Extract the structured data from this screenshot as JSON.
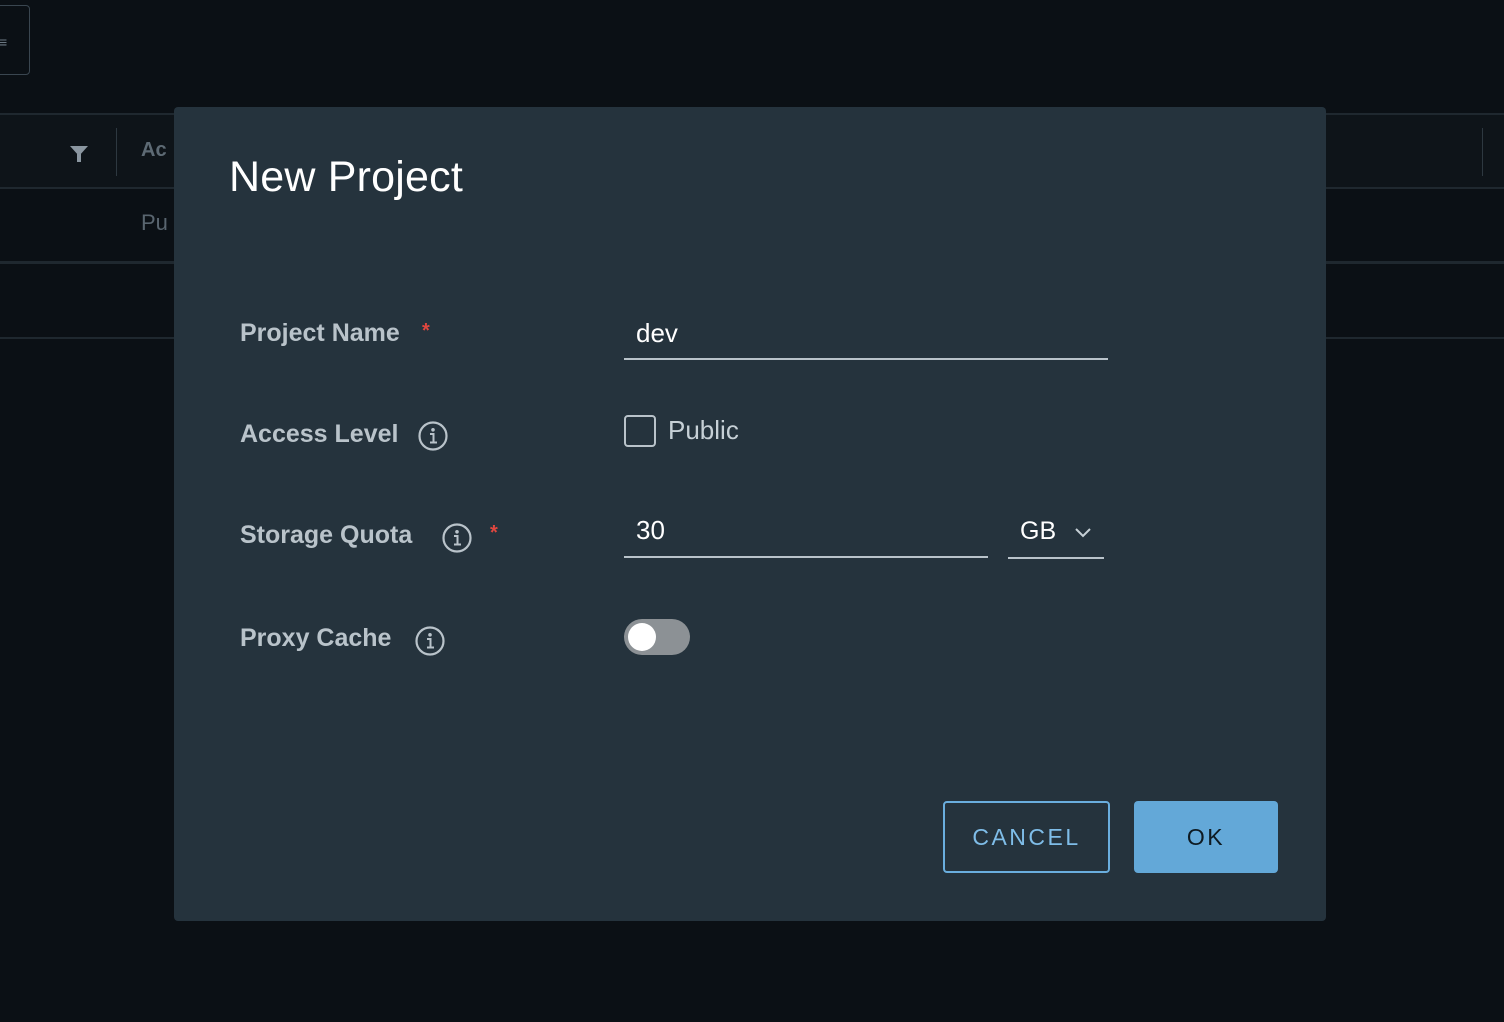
{
  "background": {
    "column_header_partial": "Ac",
    "cell_partial": "Pu"
  },
  "modal": {
    "title": "New Project",
    "fields": {
      "project_name": {
        "label": "Project Name",
        "required_mark": "*",
        "value": "dev"
      },
      "access_level": {
        "label": "Access Level",
        "checkbox_label": "Public",
        "checked": false
      },
      "storage_quota": {
        "label": "Storage Quota",
        "required_mark": "*",
        "value": "30",
        "unit": "GB"
      },
      "proxy_cache": {
        "label": "Proxy Cache",
        "enabled": false
      }
    },
    "buttons": {
      "cancel": "CANCEL",
      "ok": "OK"
    }
  },
  "colors": {
    "modal_bg": "#25333d",
    "page_bg": "#0b1015",
    "accent": "#63a8d8",
    "required": "#e1473f"
  },
  "icons": [
    "filter-icon",
    "info-icon",
    "chevron-down-icon"
  ]
}
